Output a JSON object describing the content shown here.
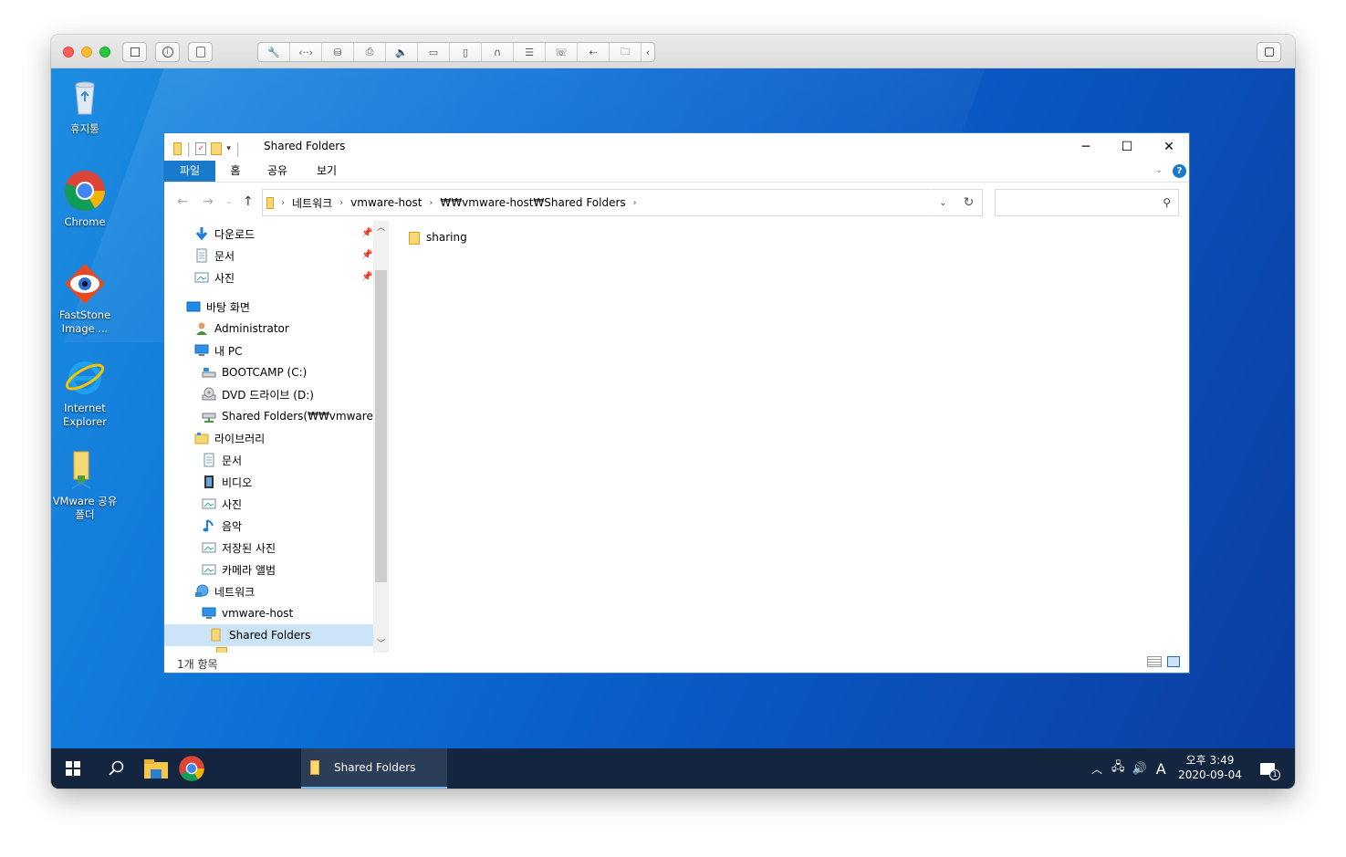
{
  "colors": {
    "desktop": "#0b6fd6",
    "taskbar": "#14253f",
    "accent": "#1979ca",
    "selection": "#cce4f7"
  },
  "desktop_icons": [
    {
      "label": "휴지통",
      "icon": "recycle-bin-icon"
    },
    {
      "label": "Chrome",
      "icon": "chrome-icon"
    },
    {
      "label": "FastStone Image ...",
      "icon": "faststone-icon"
    },
    {
      "label": "Internet Explorer",
      "icon": "internet-explorer-icon"
    },
    {
      "label": "VMware 공유 폴더",
      "icon": "vmware-shared-folder-icon"
    }
  ],
  "window": {
    "title": "Shared Folders",
    "controls": {
      "minimize": "─",
      "maximize": "☐",
      "close": "✕"
    }
  },
  "ribbon": {
    "tabs": [
      "파일",
      "홈",
      "공유",
      "보기"
    ]
  },
  "address": {
    "segments": [
      "네트워크",
      "vmware-host",
      "₩₩vmware-host₩Shared Folders"
    ]
  },
  "nav": {
    "items": [
      {
        "label": "다운로드",
        "icon": "download-arrow-icon",
        "pinned": true
      },
      {
        "label": "문서",
        "icon": "document-icon",
        "pinned": true
      },
      {
        "label": "사진",
        "icon": "pictures-icon",
        "pinned": true
      },
      {
        "label": "바탕 화면",
        "icon": "desktop-icon"
      },
      {
        "label": "Administrator",
        "icon": "user-icon"
      },
      {
        "label": "내 PC",
        "icon": "computer-icon"
      },
      {
        "label": "BOOTCAMP (C:)",
        "icon": "drive-icon"
      },
      {
        "label": "DVD 드라이브 (D:)",
        "icon": "dvd-drive-icon"
      },
      {
        "label": "Shared Folders(₩₩vmware-hos",
        "icon": "network-drive-icon"
      },
      {
        "label": "라이브러리",
        "icon": "library-icon"
      },
      {
        "label": "문서",
        "icon": "document-icon"
      },
      {
        "label": "비디오",
        "icon": "video-icon"
      },
      {
        "label": "사진",
        "icon": "pictures-icon"
      },
      {
        "label": "음악",
        "icon": "music-icon"
      },
      {
        "label": "저장된 사진",
        "icon": "pictures-icon"
      },
      {
        "label": "카메라 앨범",
        "icon": "pictures-icon"
      },
      {
        "label": "네트워크",
        "icon": "network-icon"
      },
      {
        "label": "vmware-host",
        "icon": "computer-icon"
      },
      {
        "label": "Shared Folders",
        "icon": "folder-icon",
        "selected": true
      }
    ]
  },
  "content": {
    "files": [
      {
        "name": "sharing",
        "icon": "folder-icon"
      }
    ]
  },
  "status": {
    "count": "1개 항목"
  },
  "taskbar": {
    "active_window": "Shared Folders",
    "ime": "A",
    "time": "오후 3:49",
    "date": "2020-09-04",
    "notification_count": "1"
  }
}
